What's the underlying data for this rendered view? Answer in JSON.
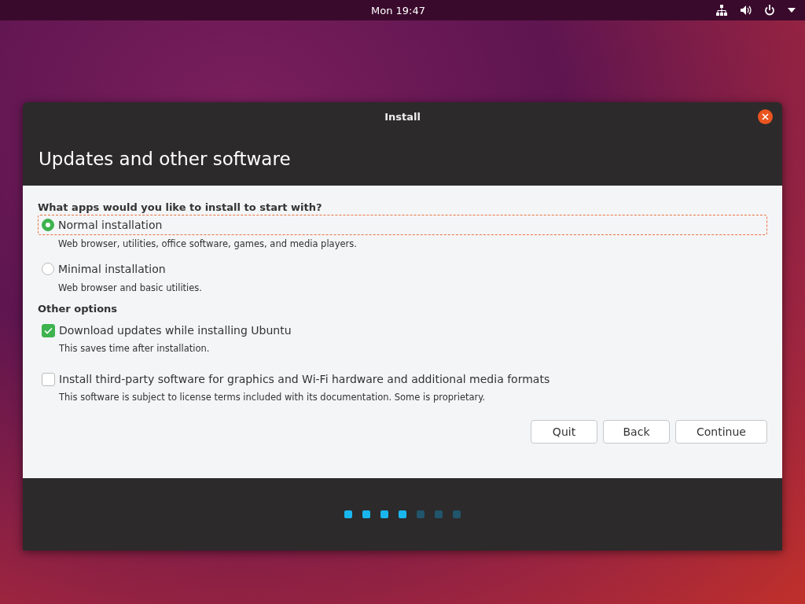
{
  "top_bar": {
    "clock": "Mon 19:47"
  },
  "window": {
    "title": "Install"
  },
  "page": {
    "heading": "Updates and other software"
  },
  "install_type": {
    "question": "What apps would you like to install to start with?",
    "options": [
      {
        "label": "Normal installation",
        "description": "Web browser, utilities, office software, games, and media players.",
        "selected": true,
        "focused": true
      },
      {
        "label": "Minimal installation",
        "description": "Web browser and basic utilities.",
        "selected": false,
        "focused": false
      }
    ]
  },
  "other_options": {
    "heading": "Other options",
    "options": [
      {
        "label": "Download updates while installing Ubuntu",
        "description": "This saves time after installation.",
        "checked": true
      },
      {
        "label": "Install third-party software for graphics and Wi-Fi hardware and additional media formats",
        "description": "This software is subject to license terms included with its documentation. Some is proprietary.",
        "checked": false
      }
    ]
  },
  "buttons": [
    "Quit",
    "Back",
    "Continue"
  ],
  "progress_steps": [
    {
      "done": true
    },
    {
      "done": true
    },
    {
      "done": true
    },
    {
      "done": true
    },
    {
      "done": false
    },
    {
      "done": false
    },
    {
      "done": false
    }
  ]
}
